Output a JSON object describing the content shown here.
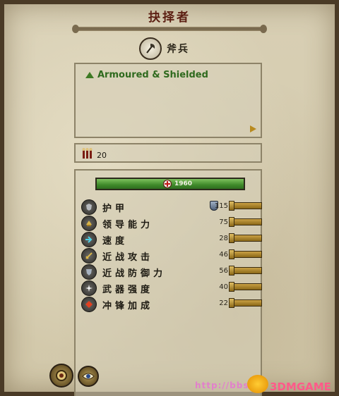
{
  "title": "抉择者",
  "unit": {
    "name": "斧兵",
    "icon": "axe-icon"
  },
  "abilities": [
    {
      "label": "Armoured & Shielded",
      "icon": "green-triangle-icon"
    }
  ],
  "unit_count": {
    "value": "20",
    "icon": "soldiers-icon"
  },
  "health": {
    "value": "1960",
    "icon": "red-cross-icon",
    "color": "#3f8a2a"
  },
  "stats": [
    {
      "label": "护甲",
      "value": "115",
      "icon": "armour-icon",
      "extra_icon": "shield-icon"
    },
    {
      "label": "领导能力",
      "value": "75",
      "icon": "leadership-icon"
    },
    {
      "label": "速度",
      "value": "28",
      "icon": "speed-icon"
    },
    {
      "label": "近战攻击",
      "value": "46",
      "icon": "melee-attack-icon"
    },
    {
      "label": "近战防御力",
      "value": "56",
      "icon": "melee-defence-icon"
    },
    {
      "label": "武器强度",
      "value": "40",
      "icon": "weapon-strength-icon"
    },
    {
      "label": "冲锋加成",
      "value": "22",
      "icon": "charge-bonus-icon"
    }
  ],
  "bottom_buttons": [
    {
      "icon": "unit-portrait-icon"
    },
    {
      "icon": "eye-icon"
    }
  ],
  "watermark": {
    "url": "http://bbs",
    "brand": "3DMGAME"
  },
  "colors": {
    "title": "#5c1f12",
    "ability": "#2f6a1e",
    "bar_gold": "#c9a044"
  }
}
